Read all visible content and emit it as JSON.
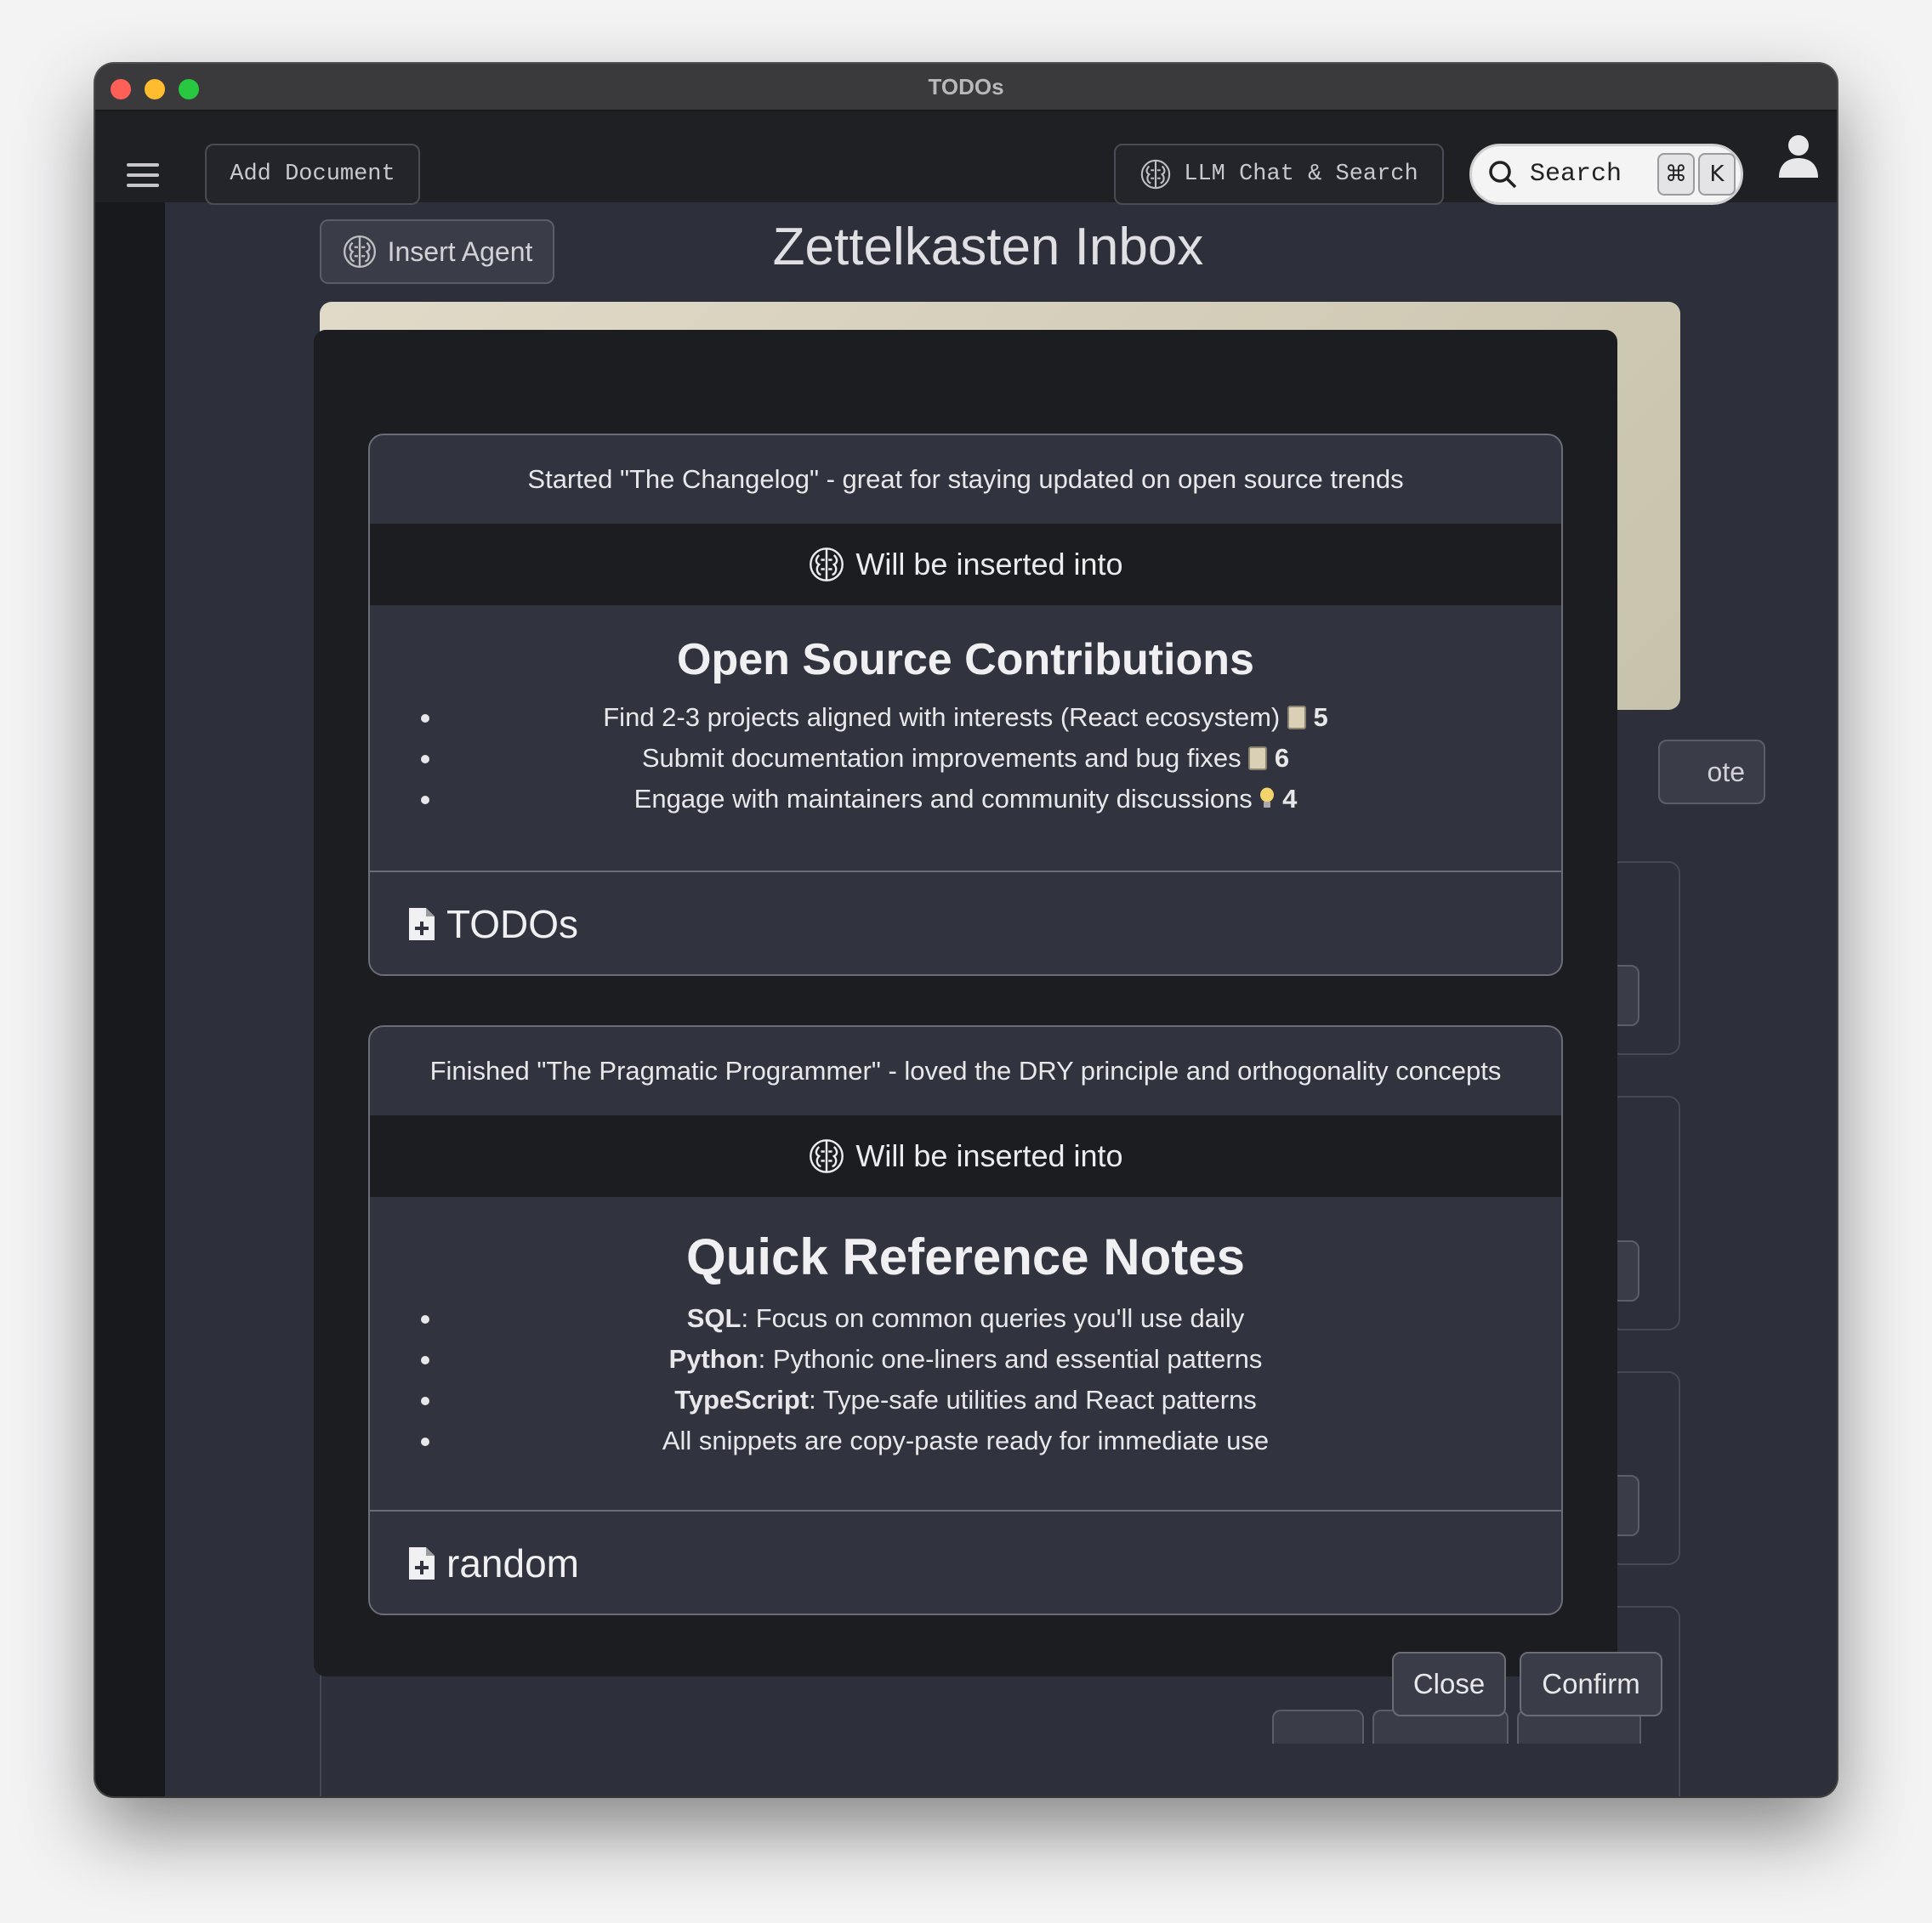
{
  "window": {
    "title": "TODOs"
  },
  "toolbar": {
    "add_document": "Add Document",
    "llm_chat": "LLM Chat & Search",
    "search_label": "Search",
    "shortcut_mod": "⌘",
    "shortcut_key": "K"
  },
  "page": {
    "insert_agent": "Insert Agent",
    "title": "Zettelkasten Inbox",
    "partial_button": "ote"
  },
  "modal": {
    "suggestions": [
      {
        "source": "Started \"The Changelog\" - great for staying updated on open source trends",
        "insert_label": "Will be inserted into",
        "title": "Open Source Contributions",
        "items": [
          {
            "text": "Find 2-3 projects aligned with interests (React ecosystem)",
            "num": "5",
            "emoji": "doc"
          },
          {
            "text": "Submit documentation improvements and bug fixes",
            "num": "6",
            "emoji": "doc"
          },
          {
            "text": "Engage with maintainers and community discussions",
            "num": "4",
            "emoji": "bulb"
          }
        ],
        "target": "TODOs"
      },
      {
        "source": "Finished \"The Pragmatic Programmer\" - loved the DRY principle and orthogonality concepts",
        "insert_label": "Will be inserted into",
        "title": "Quick Reference Notes",
        "items": [
          {
            "bold": "SQL",
            "text": ": Focus on common queries you'll use daily"
          },
          {
            "bold": "Python",
            "text": ": Pythonic one-liners and essential patterns"
          },
          {
            "bold": "TypeScript",
            "text": ": Type-safe utilities and React patterns"
          },
          {
            "bold": "",
            "text": "All snippets are copy-paste ready for immediate use"
          }
        ],
        "target": "random"
      }
    ],
    "close": "Close",
    "confirm": "Confirm"
  }
}
